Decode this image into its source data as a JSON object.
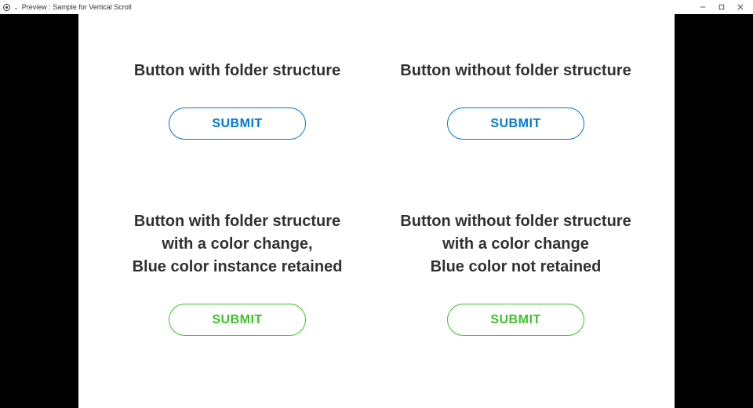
{
  "window": {
    "title": "Preview : Sample for Vertical Scroll"
  },
  "colors": {
    "blue": "#0078d4",
    "green": "#3ac426"
  },
  "cells": {
    "top_left": {
      "heading": "Button with folder structure",
      "button": "SUBMIT"
    },
    "top_right": {
      "heading": "Button without folder structure",
      "button": "SUBMIT"
    },
    "bottom_left": {
      "heading": "Button with folder structure\nwith a color change,\nBlue color instance retained",
      "button": "SUBMIT"
    },
    "bottom_right": {
      "heading": "Button without folder structure\nwith a color change\nBlue color not retained",
      "button": "SUBMIT"
    }
  }
}
